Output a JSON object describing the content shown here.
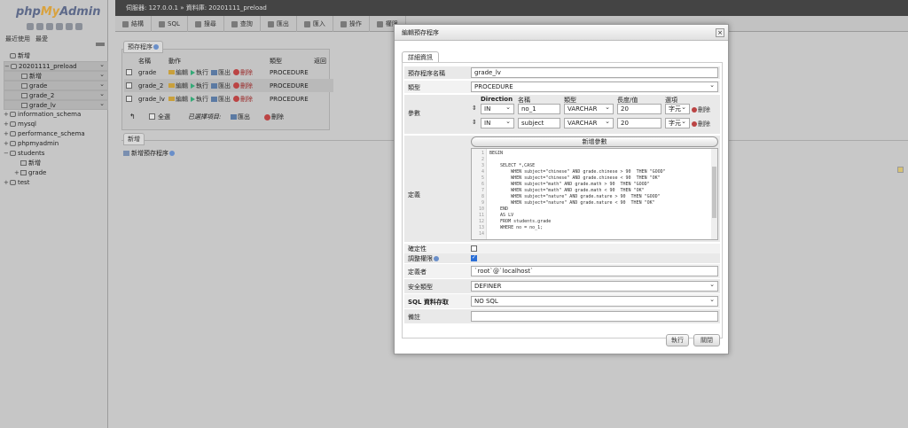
{
  "nav": {
    "logo_php": "php",
    "logo_my": "My",
    "logo_admin": "Admin",
    "links": [
      "最近使用",
      "最愛"
    ],
    "tree": [
      {
        "label": "新增",
        "depth": 0,
        "sel": false,
        "toggle": ""
      },
      {
        "label": "20201111_preload",
        "depth": 0,
        "sel": true,
        "toggle": "−"
      },
      {
        "label": "新增",
        "depth": 1,
        "sel": true,
        "toggle": ""
      },
      {
        "label": "grade",
        "depth": 1,
        "sel": true,
        "toggle": ""
      },
      {
        "label": "grade_2",
        "depth": 1,
        "sel": true,
        "toggle": ""
      },
      {
        "label": "grade_lv",
        "depth": 1,
        "sel": true,
        "toggle": ""
      },
      {
        "label": "information_schema",
        "depth": 0,
        "sel": false,
        "toggle": "+"
      },
      {
        "label": "mysql",
        "depth": 0,
        "sel": false,
        "toggle": "+"
      },
      {
        "label": "performance_schema",
        "depth": 0,
        "sel": false,
        "toggle": "+"
      },
      {
        "label": "phpmyadmin",
        "depth": 0,
        "sel": false,
        "toggle": "+"
      },
      {
        "label": "students",
        "depth": 0,
        "sel": false,
        "toggle": "−"
      },
      {
        "label": "新增",
        "depth": 1,
        "sel": false,
        "toggle": ""
      },
      {
        "label": "grade",
        "depth": 1,
        "sel": false,
        "toggle": "+"
      },
      {
        "label": "test",
        "depth": 0,
        "sel": false,
        "toggle": "+"
      }
    ]
  },
  "serverbar": "伺服器: 127.0.0.1 » 資料庫: 20201111_preload",
  "tabs": [
    "結構",
    "SQL",
    "搜尋",
    "查詢",
    "匯出",
    "匯入",
    "操作",
    "權限"
  ],
  "routines": {
    "legend": "預存程序",
    "headers": [
      "名稱",
      "動作",
      "類型",
      "返回"
    ],
    "actions": {
      "edit": "編輯",
      "exec": "執行",
      "export": "匯出",
      "drop": "刪除"
    },
    "rows": [
      {
        "name": "grade",
        "type": "PROCEDURE"
      },
      {
        "name": "grade_2",
        "type": "PROCEDURE"
      },
      {
        "name": "grade_lv",
        "type": "PROCEDURE"
      }
    ],
    "select_all": "全選",
    "with_selected": "已選擇項目:",
    "export": "匯出",
    "drop": "刪除"
  },
  "new_section": {
    "legend": "新增",
    "add_routine": "新增預存程序"
  },
  "modal": {
    "title": "編輯預存程序",
    "close": "×",
    "details_tab": "詳細資訊",
    "name_label": "預存程序名稱",
    "name_value": "grade_lv",
    "type_label": "類型",
    "type_value": "PROCEDURE",
    "params_label": "參數",
    "param_headers": [
      "Direction",
      "名稱",
      "類型",
      "長度/值",
      "選項"
    ],
    "params": [
      {
        "direction": "IN",
        "name": "no_1",
        "type": "VARCHAR",
        "length": "20",
        "option": "字元"
      },
      {
        "direction": "IN",
        "name": "subject",
        "type": "VARCHAR",
        "length": "20",
        "option": "字元"
      }
    ],
    "param_remove": "刪除",
    "add_param": "新增參數",
    "definition_label": "定義",
    "code_lines": [
      "BEGIN",
      "",
      "    SELECT *,CASE",
      "        WHEN subject=\"chinese\" AND grade.chinese > 90  THEN \"GOOD\"",
      "        WHEN subject=\"chinese\" AND grade.chinese < 90  THEN \"OK\"",
      "        WHEN subject=\"math\" AND grade.math > 90  THEN \"GOOD\"",
      "        WHEN subject=\"math\" AND grade.math < 90  THEN \"OK\"",
      "        WHEN subject=\"nature\" AND grade.nature > 90  THEN \"GOOD\"",
      "        WHEN subject=\"nature\" AND grade.nature < 90  THEN \"OK\"",
      "    END",
      "    AS LV",
      "    FROM students.grade",
      "    WHERE no = no_1;",
      ""
    ],
    "deterministic_label": "確定性",
    "adjust_privileges_label": "調整權限",
    "definer_label": "定義者",
    "definer_value": "`root`@`localhost`",
    "security_label": "安全類型",
    "security_value": "DEFINER",
    "sql_access_label": "SQL 資料存取",
    "sql_access_value": "NO SQL",
    "comment_label": "備註",
    "comment_value": "",
    "go_button": "執行",
    "close_button": "關閉"
  },
  "colors": {
    "modal_bg": "#ffffff",
    "nav_bg": "#c6c6c6",
    "serverbar_bg": "#444444"
  }
}
